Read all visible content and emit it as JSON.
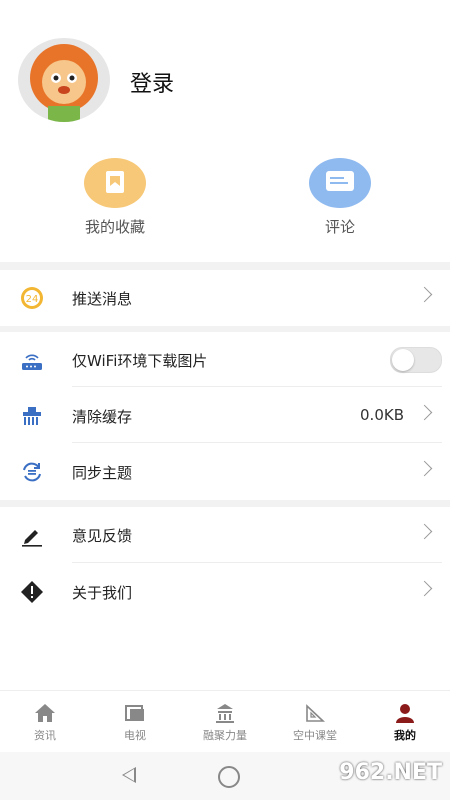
{
  "profile": {
    "login_label": "登录"
  },
  "quick_actions": [
    {
      "label": "我的收藏",
      "icon": "bookmark-icon",
      "color": "#f7c877"
    },
    {
      "label": "评论",
      "icon": "comment-icon",
      "color": "#8fbaf0"
    }
  ],
  "settings": {
    "push": {
      "label": "推送消息",
      "badge": "24"
    },
    "wifi_only": {
      "label": "仅WiFi环境下载图片",
      "enabled": false
    },
    "clear_cache": {
      "label": "清除缓存",
      "value": "0.0KB"
    },
    "sync_theme": {
      "label": "同步主题"
    },
    "feedback": {
      "label": "意见反馈"
    },
    "about": {
      "label": "关于我们"
    }
  },
  "tabs": [
    {
      "label": "资讯",
      "icon": "home-icon",
      "active": false
    },
    {
      "label": "电视",
      "icon": "tv-icon",
      "active": false
    },
    {
      "label": "融聚力量",
      "icon": "temple-icon",
      "active": false
    },
    {
      "label": "空中课堂",
      "icon": "ruler-icon",
      "active": false
    },
    {
      "label": "我的",
      "icon": "person-icon",
      "active": true
    }
  ],
  "watermark": "962.NET"
}
